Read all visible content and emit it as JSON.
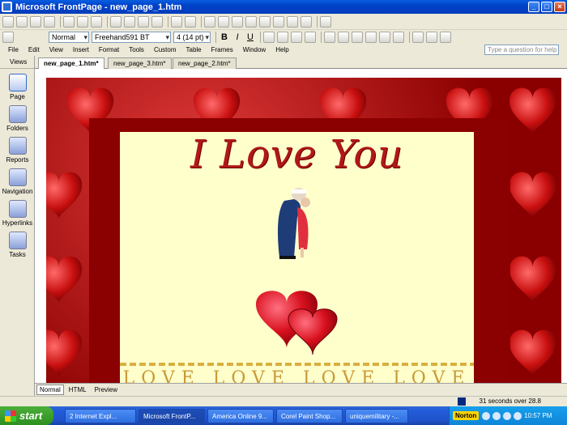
{
  "window": {
    "title": "Microsoft FrontPage - new_page_1.htm",
    "minimize": "_",
    "maximize": "□",
    "close": "×"
  },
  "format_bar": {
    "style": "Normal",
    "font": "Freehand591 BT",
    "size": "4 (14 pt)",
    "bold": "B",
    "italic": "I",
    "underline": "U"
  },
  "menu": [
    "File",
    "Edit",
    "View",
    "Insert",
    "Format",
    "Tools",
    "Custom",
    "Table",
    "Frames",
    "Window",
    "Help"
  ],
  "help_box": {
    "placeholder": "Type a question for help"
  },
  "views": {
    "header": "Views",
    "items": [
      "Page",
      "Folders",
      "Reports",
      "Navigation",
      "Hyperlinks",
      "Tasks"
    ]
  },
  "tabs": [
    "new_page_1.htm*",
    "new_page_3.htm*",
    "new_page_2.htm*"
  ],
  "page": {
    "heading": "I Love You",
    "love_row": "LOVE LOVE LOVE LOVE"
  },
  "modes": [
    "Normal",
    "HTML",
    "Preview"
  ],
  "status": {
    "text": "31 seconds over 28.8"
  },
  "taskbar": {
    "start": "start",
    "tasks": [
      "2 Internet Expl...",
      "Microsoft FrontP...",
      "America Online 9...",
      "Corel Paint Shop...",
      "uniquemilitary -..."
    ],
    "norton": "Norton",
    "clock": "10:57 PM"
  },
  "colors": {
    "titlebar": "#0041c8",
    "panel": "#ffffcc",
    "frame": "#8b0000",
    "heading": "#b01818"
  }
}
